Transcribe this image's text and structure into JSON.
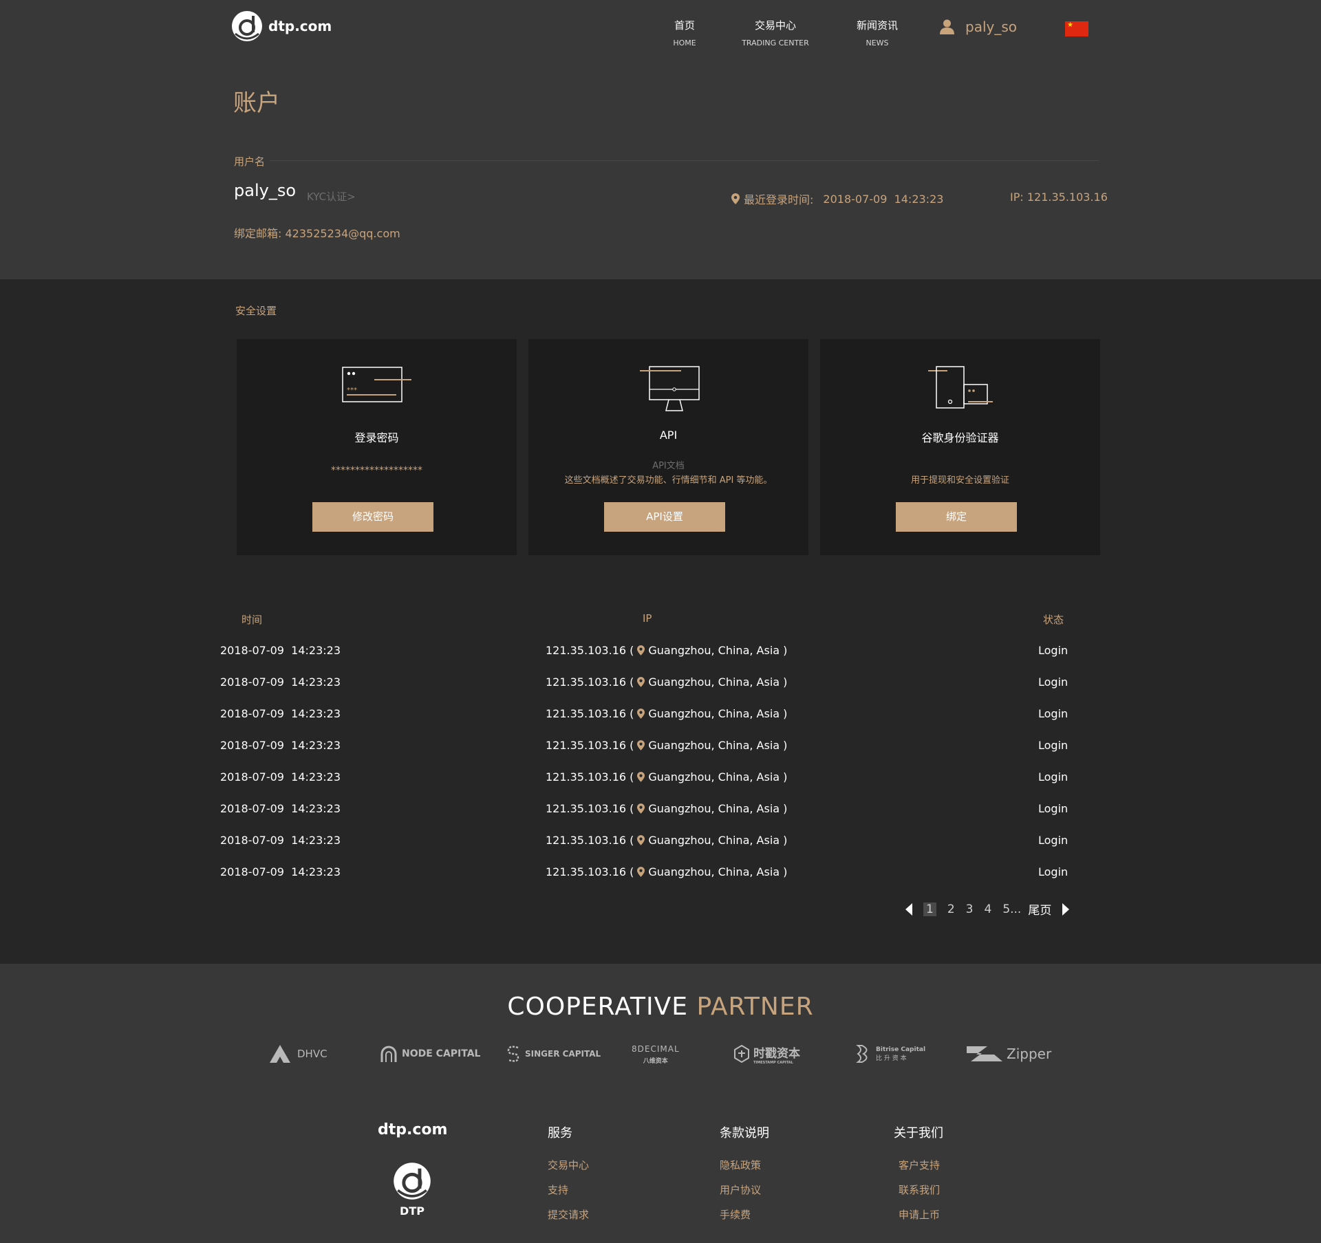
{
  "header": {
    "logo_text": "dtp.com",
    "nav": [
      {
        "cn": "首页",
        "en": "HOME"
      },
      {
        "cn": "交易中心",
        "en": "TRADING CENTER"
      },
      {
        "cn": "新闻资讯",
        "en": "NEWS"
      }
    ],
    "username": "paly_so"
  },
  "account": {
    "title": "账户",
    "username_label": "用户名",
    "username": "paly_so",
    "kyc_link": "KYC认证>",
    "last_login_label": "最近登录时间:",
    "last_login_value": "2018-07-09  14:23:23",
    "ip": "IP: 121.35.103.16",
    "email_label": "绑定邮箱:",
    "email": "423525234@qq.com"
  },
  "security": {
    "title": "安全设置",
    "cards": [
      {
        "title": "登录密码",
        "desc": "*******************",
        "button": "修改密码"
      },
      {
        "title": "API",
        "subdesc": "API文档",
        "desc": "这些文档概述了交易功能、行情细节和 API 等功能。",
        "button": "API设置"
      },
      {
        "title": "谷歌身份验证器",
        "desc": "用于提现和安全设置验证",
        "button": "绑定"
      }
    ]
  },
  "log_table": {
    "headers": [
      "时间",
      "IP",
      "状态"
    ],
    "rows": [
      {
        "time": "2018-07-09  14:23:23",
        "ip": "121.35.103.16 (",
        "loc": "Guangzhou, China, Asia )",
        "status": "Login"
      },
      {
        "time": "2018-07-09  14:23:23",
        "ip": "121.35.103.16 (",
        "loc": "Guangzhou, China, Asia )",
        "status": "Login"
      },
      {
        "time": "2018-07-09  14:23:23",
        "ip": "121.35.103.16 (",
        "loc": "Guangzhou, China, Asia )",
        "status": "Login"
      },
      {
        "time": "2018-07-09  14:23:23",
        "ip": "121.35.103.16 (",
        "loc": "Guangzhou, China, Asia )",
        "status": "Login"
      },
      {
        "time": "2018-07-09  14:23:23",
        "ip": "121.35.103.16 (",
        "loc": "Guangzhou, China, Asia )",
        "status": "Login"
      },
      {
        "time": "2018-07-09  14:23:23",
        "ip": "121.35.103.16 (",
        "loc": "Guangzhou, China, Asia )",
        "status": "Login"
      },
      {
        "time": "2018-07-09  14:23:23",
        "ip": "121.35.103.16 (",
        "loc": "Guangzhou, China, Asia )",
        "status": "Login"
      },
      {
        "time": "2018-07-09  14:23:23",
        "ip": "121.35.103.16 (",
        "loc": "Guangzhou, China, Asia )",
        "status": "Login"
      }
    ],
    "pagination": {
      "pages": [
        "1",
        "2",
        "3",
        "4",
        "5..."
      ],
      "current": "1",
      "last": "尾页"
    }
  },
  "partners": {
    "title_a": "COOPERATIVE",
    "title_b": "PARTNER",
    "logos": [
      "DHVC",
      "NODE CAPITAL",
      "SINGER CAPITAL",
      "8DECIMAL",
      "时戳资本",
      "Bitrise Capital",
      "Zipper"
    ],
    "logo_subs": [
      "",
      "",
      "",
      "八维资本",
      "TIMESTAMP CAPITAL",
      "比 升 资 本",
      ""
    ]
  },
  "footer": {
    "logo_text": "dtp.com",
    "logo_sub": "DTP",
    "columns": [
      {
        "title": "服务",
        "links": [
          "交易中心",
          "支持",
          "提交请求"
        ]
      },
      {
        "title": "条款说明",
        "links": [
          "隐私政策",
          "用户协议",
          "手续费"
        ]
      },
      {
        "title": "关于我们",
        "links": [
          "客户支持",
          "联系我们",
          "申请上币"
        ]
      }
    ]
  },
  "colors": {
    "accent": "#c8a47d",
    "header_bg": "#383838",
    "section_bg": "#262626",
    "card_bg": "#1c1c1c"
  }
}
